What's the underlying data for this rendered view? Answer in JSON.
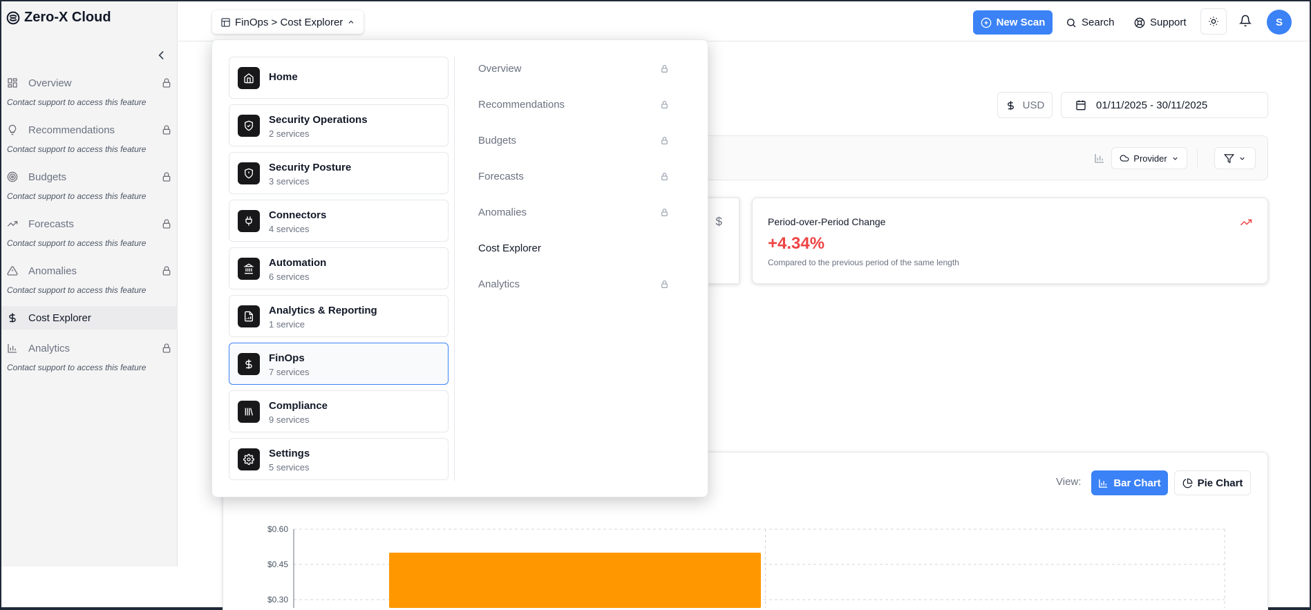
{
  "app": {
    "name": "Zero-X Cloud"
  },
  "sidebar": {
    "items": [
      {
        "label": "Overview",
        "icon": "grid-icon",
        "locked": true,
        "note": "Contact support to access this feature"
      },
      {
        "label": "Recommendations",
        "icon": "lightbulb-icon",
        "locked": true,
        "note": "Contact support to access this feature"
      },
      {
        "label": "Budgets",
        "icon": "target-icon",
        "locked": true,
        "note": "Contact support to access this feature"
      },
      {
        "label": "Forecasts",
        "icon": "trending-up-icon",
        "locked": true,
        "note": "Contact support to access this feature"
      },
      {
        "label": "Anomalies",
        "icon": "warning-icon",
        "locked": true,
        "note": "Contact support to access this feature"
      },
      {
        "label": "Cost Explorer",
        "icon": "dollar-icon",
        "locked": false,
        "active": true
      },
      {
        "label": "Analytics",
        "icon": "bar-chart-icon",
        "locked": true,
        "note": "Contact support to access this feature"
      }
    ]
  },
  "topbar": {
    "breadcrumb": "FinOps > Cost Explorer",
    "new_scan": "New Scan",
    "search": "Search",
    "support": "Support",
    "avatar_initial": "S"
  },
  "menu": {
    "categories": [
      {
        "name": "Home",
        "sub": ""
      },
      {
        "name": "Security Operations",
        "sub": "2 services"
      },
      {
        "name": "Security Posture",
        "sub": "3 services"
      },
      {
        "name": "Connectors",
        "sub": "4 services"
      },
      {
        "name": "Automation",
        "sub": "6 services"
      },
      {
        "name": "Analytics & Reporting",
        "sub": "1 service"
      },
      {
        "name": "FinOps",
        "sub": "7 services",
        "selected": true
      },
      {
        "name": "Compliance",
        "sub": "9 services"
      },
      {
        "name": "Settings",
        "sub": "5 services"
      }
    ],
    "items": [
      {
        "label": "Overview",
        "locked": true
      },
      {
        "label": "Recommendations",
        "locked": true
      },
      {
        "label": "Budgets",
        "locked": true
      },
      {
        "label": "Forecasts",
        "locked": true
      },
      {
        "label": "Anomalies",
        "locked": true
      },
      {
        "label": "Cost Explorer",
        "locked": false
      },
      {
        "label": "Analytics",
        "locked": true
      }
    ]
  },
  "filters": {
    "currency": "USD",
    "date_range": "01/11/2025 - 30/11/2025",
    "provider": "Provider"
  },
  "cards": {
    "pop_title": "Period-over-Period Change",
    "pop_value": "+4.34%",
    "pop_sub": "Compared to the previous period of the same length",
    "left_card_symbol": "$"
  },
  "chart_view": {
    "label": "View:",
    "bar": "Bar Chart",
    "pie": "Pie Chart"
  },
  "colors": {
    "primary": "#3b82f6",
    "negative": "#ef4444",
    "bar": "#ff9800"
  },
  "chart_data": {
    "type": "bar",
    "y_ticks": [
      "$0.60",
      "$0.45",
      "$0.30"
    ],
    "ylim": [
      0.3,
      0.6
    ],
    "values": [
      0.5
    ],
    "series_colors": [
      "#ff9800"
    ]
  }
}
